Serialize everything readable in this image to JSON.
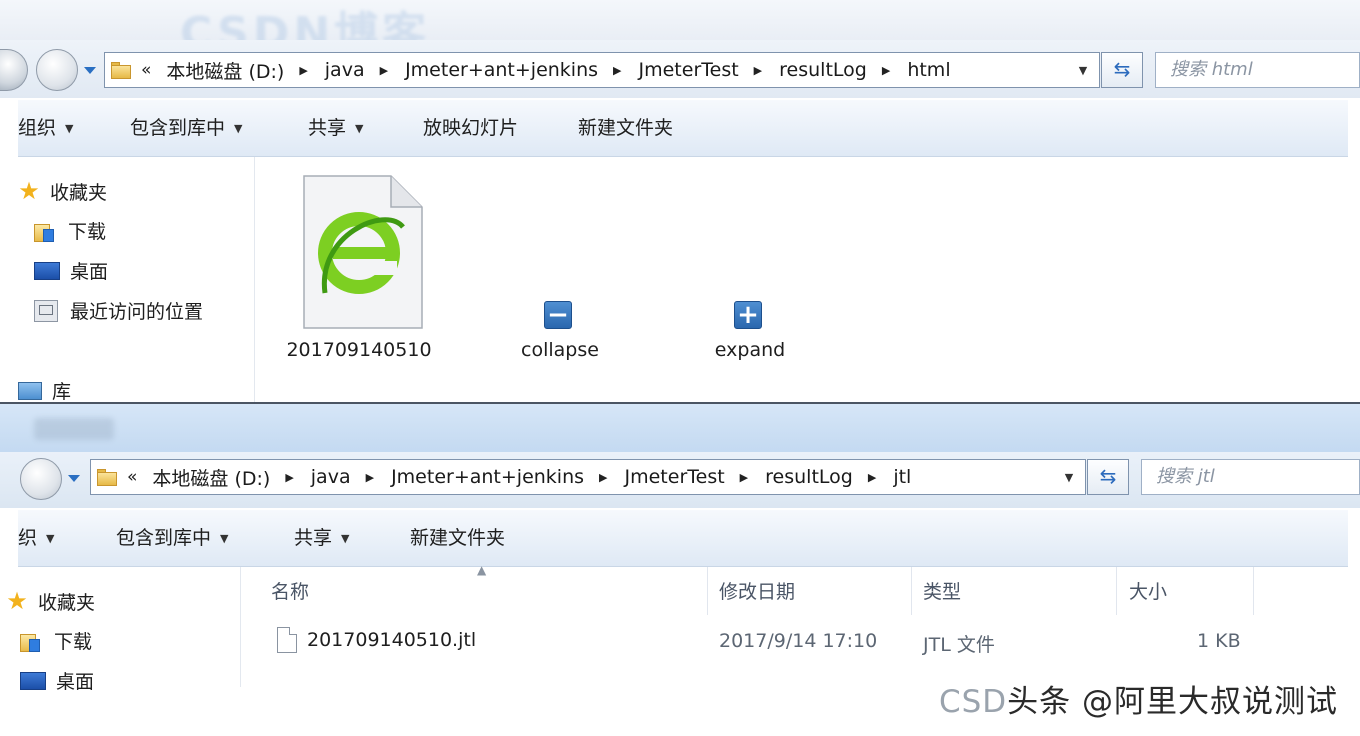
{
  "top_window": {
    "title_watermark": "CSDN博客",
    "address": {
      "prefix": "«",
      "segments": [
        "本地磁盘 (D:)",
        "java",
        "Jmeter+ant+jenkins",
        "JmeterTest",
        "resultLog",
        "html"
      ],
      "dropdown_icon": "chevron-down-icon"
    },
    "refresh_icon": "refresh-icon",
    "search_placeholder": "搜索 html",
    "toolbar": {
      "organize": "组织",
      "include_in_library": "包含到库中",
      "share": "共享",
      "slideshow": "放映幻灯片",
      "new_folder": "新建文件夹"
    },
    "sidebar": {
      "favorites": "收藏夹",
      "downloads": "下载",
      "desktop": "桌面",
      "recent_places": "最近访问的位置",
      "libraries": "库"
    },
    "files": [
      {
        "name": "201709140510",
        "icon": "ie-html-icon"
      },
      {
        "name": "collapse",
        "icon": "minus-square-icon"
      },
      {
        "name": "expand",
        "icon": "plus-square-icon"
      }
    ]
  },
  "bottom_window": {
    "address": {
      "prefix": "«",
      "segments": [
        "本地磁盘 (D:)",
        "java",
        "Jmeter+ant+jenkins",
        "JmeterTest",
        "resultLog",
        "jtl"
      ]
    },
    "search_placeholder": "搜索 jtl",
    "toolbar": {
      "organize": "织",
      "include_in_library": "包含到库中",
      "share": "共享",
      "new_folder": "新建文件夹"
    },
    "sidebar": {
      "favorites": "收藏夹",
      "downloads": "下载",
      "desktop": "桌面"
    },
    "columns": [
      "名称",
      "修改日期",
      "类型",
      "大小"
    ],
    "rows": [
      {
        "name": "201709140510.jtl",
        "modified": "2017/9/14 17:10",
        "type": "JTL 文件",
        "size": "1 KB"
      }
    ]
  },
  "watermark": {
    "csd": "CSD",
    "text": "头条 @阿里大叔说测试"
  },
  "colors": {
    "accent_blue": "#2a67ae",
    "nav_bg": "#e1e9f3",
    "ie_green": "#6cc01e"
  }
}
